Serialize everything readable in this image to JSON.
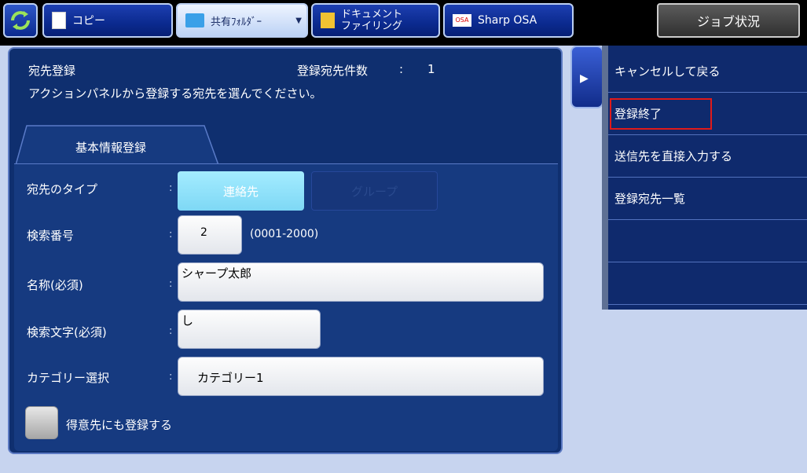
{
  "topbar": {
    "tabs": [
      {
        "label": "コピー"
      },
      {
        "label": "共有ﾌｫﾙﾀﾞｰ"
      },
      {
        "label": "ドキュメント\nファイリング"
      },
      {
        "label": "Sharp OSA"
      }
    ],
    "job_status": "ジョブ状況"
  },
  "panel": {
    "title": "宛先登録",
    "count_label": "登録宛先件数",
    "count_colon": ":",
    "count_value": "1",
    "instruction": "アクションパネルから登録する宛先を選んでください。",
    "tab_label": "基本情報登録",
    "colon": ":",
    "fields": {
      "type_label": "宛先のタイプ",
      "type_contact": "連絡先",
      "type_group": "グループ",
      "search_no_label": "検索番号",
      "search_no_value": "2",
      "search_no_range": "(0001-2000)",
      "name_label": "名称(必須)",
      "name_value": "シャープ太郎",
      "search_char_label": "検索文字(必須)",
      "search_char_value": "し",
      "category_label": "カテゴリー選択",
      "category_value": "カテゴリー1",
      "favorite_label": "得意先にも登録する"
    }
  },
  "actions": [
    {
      "label": "キャンセルして戻る"
    },
    {
      "label": "登録終了"
    },
    {
      "label": "送信先を直接入力する"
    },
    {
      "label": "登録宛先一覧"
    },
    {
      "label": ""
    },
    {
      "label": ""
    }
  ],
  "colors": {
    "highlight": "#e01a1a",
    "panel_bg": "#0f2f6f",
    "page_bg": "#c7d4ef"
  }
}
